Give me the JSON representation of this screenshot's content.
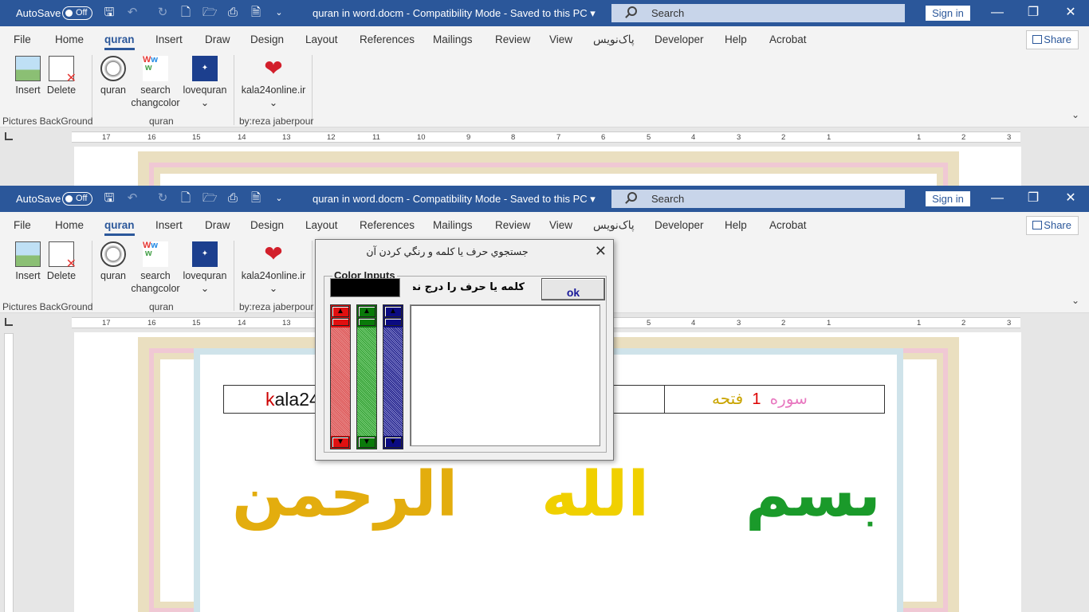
{
  "titlebar": {
    "autosave_label": "AutoSave",
    "autosave_state": "Off",
    "doc_title": "quran in word.docm  -  Compatibility Mode  -  Saved to this PC  ▾",
    "search_placeholder": "Search",
    "signin_label": "Sign in"
  },
  "tabs": [
    "File",
    "Home",
    "quran",
    "Insert",
    "Draw",
    "Design",
    "Layout",
    "References",
    "Mailings",
    "Review",
    "View",
    "پاک‌نویس",
    "Developer",
    "Help",
    "Acrobat"
  ],
  "active_tab": "quran",
  "share_label": "Share",
  "ribbon": {
    "buttons": {
      "insert": "Insert",
      "delete": "Delete",
      "quran": "quran",
      "search_changcolor_1": "search",
      "search_changcolor_2": "changcolor",
      "lovequran": "lovequran",
      "kala": "kala24online.ir",
      "dropdown_mark": "⌄"
    },
    "groups": {
      "pictures": "Pictures BackGround",
      "quran": "quran",
      "by": "by:reza jaberpour"
    }
  },
  "ruler": {
    "numbers": [
      "17",
      "16",
      "15",
      "14",
      "13",
      "12",
      "11",
      "10",
      "9",
      "8",
      "7",
      "6",
      "5",
      "4",
      "3",
      "2",
      "1",
      "1",
      "2",
      "3"
    ]
  },
  "document": {
    "header_left_1": "k",
    "header_left_2": "ala24",
    "header_right_1": "سوره",
    "header_right_2": "1",
    "header_right_3": "فتحه",
    "bism_1": "بسم",
    "bism_2": "الله",
    "bism_3": "الرحمن"
  },
  "dialog": {
    "title": "جستجوي حرف يا کلمه و رنگي کردن آن",
    "close_glyph": "✕",
    "frame_label": "Color Inputs",
    "prompt": "کلمه یا حرف را درج نمائید",
    "ok_label": "ok",
    "arrow_up": "▲",
    "arrow_down": "▼"
  },
  "colors": {
    "title_blue": "#2b579a",
    "red_bar": "#e01010",
    "green_bar": "#0a7a0a",
    "blue_bar": "#0b0b82",
    "swatch": "#000000"
  }
}
